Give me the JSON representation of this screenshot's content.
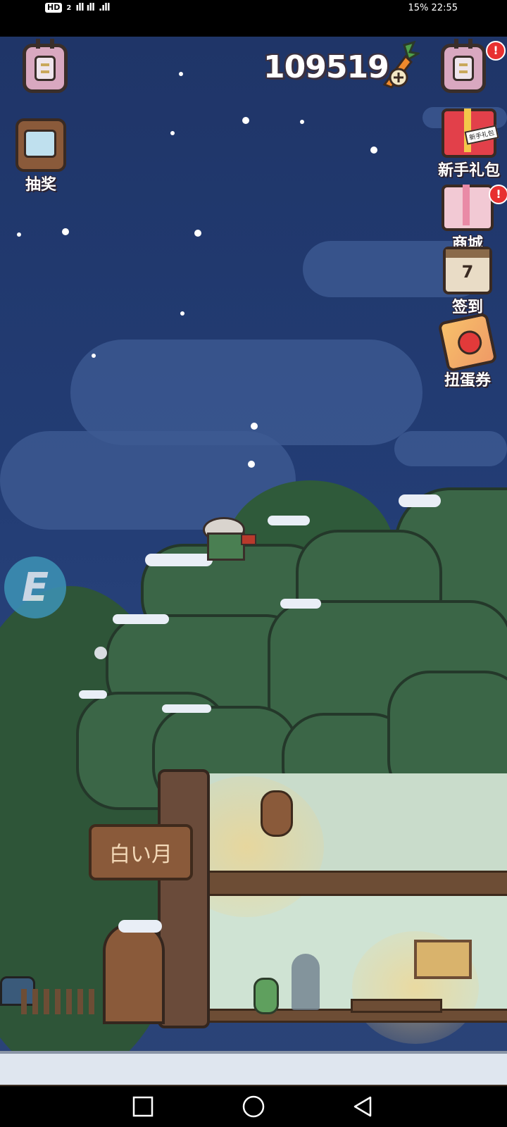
{
  "status_bar": {
    "left_badge": "HD",
    "left_badge_sub": "2",
    "signal_1": "ıll ıll",
    "signal_2": ".ıll",
    "right_text": "15% 22:55"
  },
  "hud": {
    "carrot_count": "109519"
  },
  "left_menu": {
    "lottery_label": "抽奖"
  },
  "right_menu": {
    "newbie_gift_label": "新手礼包",
    "newbie_gift_tag": "新手礼包",
    "shop_label": "商城",
    "signin_label": "签到",
    "signin_day": "7",
    "gacha_ticket_label": "扭蛋券",
    "notification_mark": "!"
  },
  "scene": {
    "sign_text": "白い月"
  },
  "floating_button": {
    "label": "E"
  },
  "colors": {
    "sky": "#233d75",
    "foliage": "#3b6647",
    "snow": "#e9eef6",
    "badge_red": "#e83030"
  }
}
